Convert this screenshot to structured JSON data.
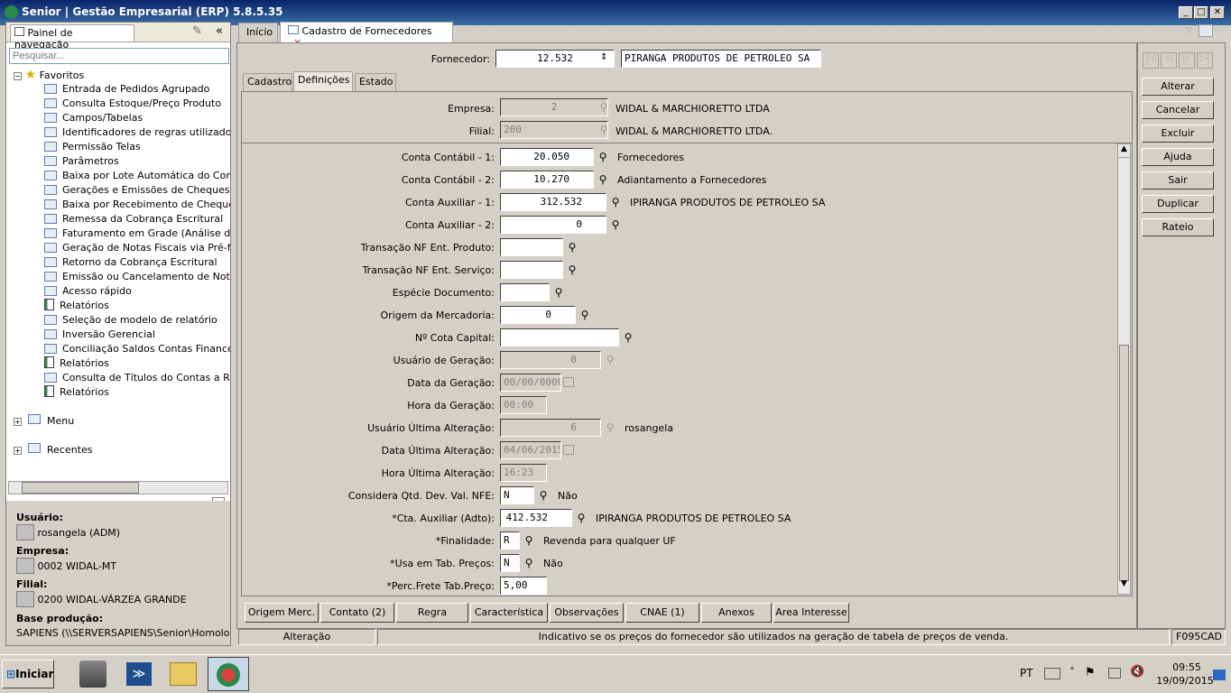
{
  "window": {
    "title": "Senior | Gestão Empresarial (ERP) 5.8.5.35"
  },
  "nav": {
    "header": "Painel de navegação",
    "search_placeholder": "Pesquisar...",
    "favorites_label": "Favoritos",
    "items": [
      {
        "label": "Entrada de Pedidos Agrupado",
        "type": "doc"
      },
      {
        "label": "Consulta Estoque/Preço Produto",
        "type": "doc"
      },
      {
        "label": "Campos/Tabelas",
        "type": "doc"
      },
      {
        "label": "Identificadores de regras utilizados",
        "type": "doc"
      },
      {
        "label": "Permissão Telas",
        "type": "doc"
      },
      {
        "label": "Parâmetros",
        "type": "doc"
      },
      {
        "label": "Baixa por Lote Automática do Conta",
        "type": "doc"
      },
      {
        "label": "Gerações e Emissões de Cheques e A",
        "type": "doc"
      },
      {
        "label": "Baixa por Recebimento de Cheques",
        "type": "doc"
      },
      {
        "label": "Remessa da Cobrança Escritural",
        "type": "doc"
      },
      {
        "label": "Faturamento em Grade (Análise de F",
        "type": "doc"
      },
      {
        "label": "Geração de Notas Fiscais via Pré-fat",
        "type": "doc"
      },
      {
        "label": "Retorno da Cobrança Escritural",
        "type": "doc"
      },
      {
        "label": "Emissão ou Cancelamento de Notas",
        "type": "doc"
      },
      {
        "label": "Acesso rápido",
        "type": "doc"
      },
      {
        "label": "Relatórios",
        "type": "rep"
      },
      {
        "label": "Seleção de modelo de relatório",
        "type": "doc"
      },
      {
        "label": "Inversão Gerencial",
        "type": "doc"
      },
      {
        "label": "Conciliação Saldos Contas Financei",
        "type": "doc"
      },
      {
        "label": "Relatórios",
        "type": "rep"
      },
      {
        "label": "Consulta de Títulos do Contas a Rec",
        "type": "doc"
      },
      {
        "label": "Relatórios",
        "type": "rep"
      }
    ],
    "menu_label": "Menu",
    "recent_label": "Recentes",
    "user_label": "Usuário:",
    "user_value": "rosangela (ADM)",
    "company_label": "Empresa:",
    "company_value": "0002 WIDAL-MT",
    "branch_label": "Filial:",
    "branch_value": "0200 WIDAL-VÁRZEA GRANDE",
    "base_label": "Base produção:",
    "base_value": "SAPIENS (\\\\SERVERSAPIENS\\Senior\\Homologa"
  },
  "tabs": {
    "home": "Início",
    "active": "Cadastro de Fornecedores"
  },
  "form": {
    "supplier_label": "Fornecedor:",
    "supplier_code": "12.532",
    "supplier_name": "PIRANGA PRODUTOS DE PETROLEO SA",
    "subtabs": [
      "Cadastro",
      "Definições",
      "Estado"
    ],
    "empresa_label": "Empresa:",
    "empresa_code": "2",
    "empresa_name": "WIDAL & MARCHIORETTO LTDA",
    "filial_label": "Filial:",
    "filial_code": "200",
    "filial_name": "WIDAL & MARCHIORETTO LTDA.",
    "fields": [
      {
        "label": "Conta Contábil - 1:",
        "value": "20.050",
        "desc": "Fornecedores"
      },
      {
        "label": "Conta Contábil - 2:",
        "value": "10.270",
        "desc": "Adiantamento a Fornecedores"
      },
      {
        "label": "Conta Auxiliar - 1:",
        "value": "312.532",
        "desc": "IPIRANGA PRODUTOS DE PETROLEO SA"
      },
      {
        "label": "Conta Auxiliar - 2:",
        "value": "0",
        "desc": ""
      },
      {
        "label": "Transação NF Ent. Produto:",
        "value": "",
        "desc": ""
      },
      {
        "label": "Transação NF Ent. Serviço:",
        "value": "",
        "desc": ""
      },
      {
        "label": "Espécie Documento:",
        "value": "",
        "desc": ""
      },
      {
        "label": "Origem da Mercadoria:",
        "value": "0",
        "desc": ""
      },
      {
        "label": "Nº Cota Capital:",
        "value": "",
        "desc": ""
      },
      {
        "label": "Usuário de Geração:",
        "value": "0",
        "desc": ""
      },
      {
        "label": "Data da Geração:",
        "value": "00/00/0000",
        "desc": ""
      },
      {
        "label": "Hora da Geração:",
        "value": "00:00",
        "desc": ""
      },
      {
        "label": "Usuário Última Alteração:",
        "value": "6",
        "desc": "rosangela"
      },
      {
        "label": "Data Última Alteração:",
        "value": "04/06/2015",
        "desc": ""
      },
      {
        "label": "Hora Última Alteração:",
        "value": "16:23",
        "desc": ""
      },
      {
        "label": "Considera Qtd. Dev. Val. NFE:",
        "value": "N",
        "desc": "Não"
      },
      {
        "label": "*Cta. Auxiliar  (Adto):",
        "value": "412.532",
        "desc": "IPIRANGA PRODUTOS DE PETROLEO SA"
      },
      {
        "label": "*Finalidade:",
        "value": "R",
        "desc": "Revenda para qualquer UF"
      },
      {
        "label": "*Usa em Tab. Preços:",
        "value": "N",
        "desc": "Não"
      },
      {
        "label": "*Perc.Frete Tab.Preço:",
        "value": "5,00",
        "desc": ""
      }
    ]
  },
  "actions": [
    "Alterar",
    "Cancelar",
    "Excluir",
    "Ajuda",
    "Sair",
    "Duplicar",
    "Rateio"
  ],
  "bottom_buttons": [
    "Origem Merc.",
    "Contato (2)",
    "Regra",
    "Característica",
    "Observações",
    "CNAE (1)",
    "Anexos",
    "Area Interesse"
  ],
  "status": {
    "mode": "Alteração",
    "hint": "Indicativo se os preços do fornecedor são utilizados na geração de tabela de preços de venda.",
    "screen": "F095CAD"
  },
  "taskbar": {
    "start": "Iniciar",
    "lang": "PT",
    "time": "09:55",
    "date": "19/09/2015"
  }
}
